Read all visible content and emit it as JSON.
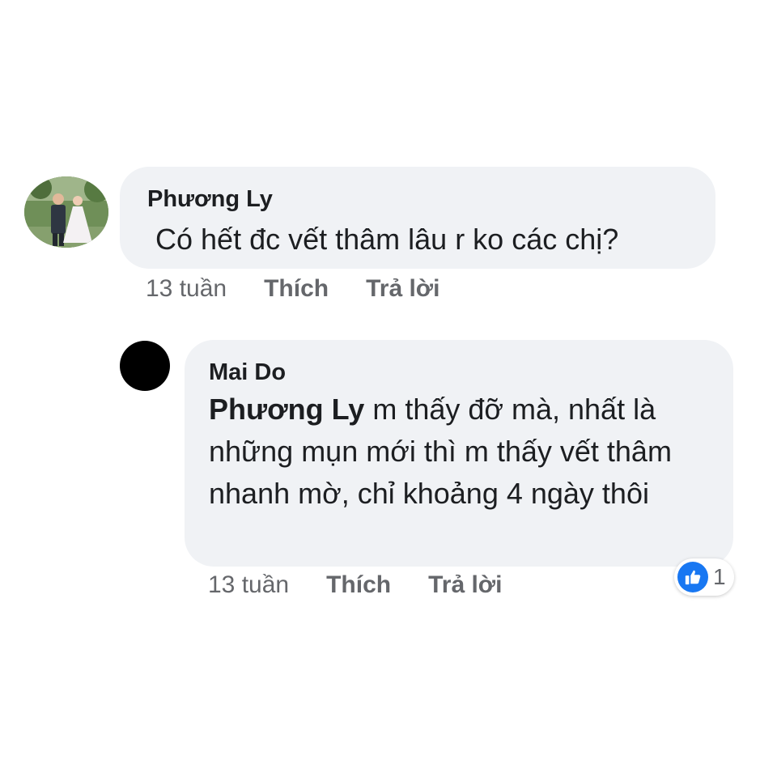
{
  "comments": [
    {
      "author": "Phương Ly",
      "text": "Có hết đc vết thâm lâu r ko các chị?",
      "time": "13 tuần",
      "like_label": "Thích",
      "reply_label": "Trả lời"
    },
    {
      "author": "Mai Do",
      "mention": "Phương Ly",
      "text": " m thấy đỡ mà, nhất là những mụn mới thì m thấy vết thâm nhanh mờ, chỉ khoảng 4 ngày thôi",
      "time": "13 tuần",
      "like_label": "Thích",
      "reply_label": "Trả lời",
      "reaction": {
        "icon": "thumbs-up-icon",
        "count": "1"
      }
    }
  ],
  "colors": {
    "bubble": "#f0f2f5",
    "text": "#1c1e21",
    "meta": "#65676b",
    "like_blue": "#1877f2"
  }
}
